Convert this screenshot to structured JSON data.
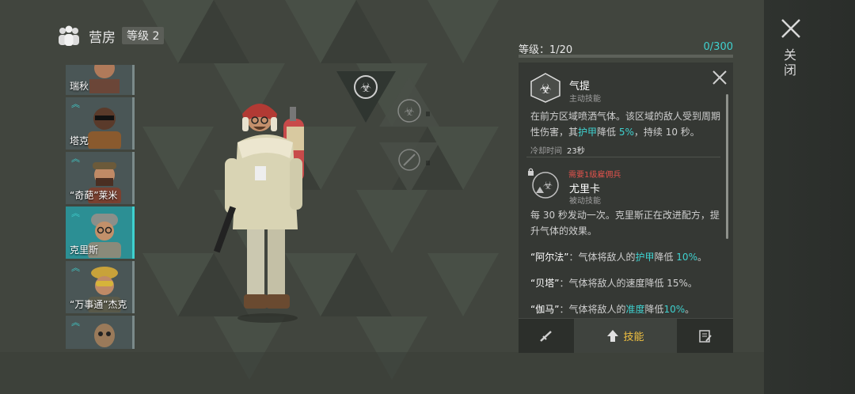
{
  "header": {
    "icon": "group-icon",
    "title": "营房",
    "level_badge": "等级 2"
  },
  "close": {
    "label": "关闭",
    "icon": "close-icon"
  },
  "roster": [
    {
      "name": "瑞秋",
      "rank_chevrons": 0,
      "selected": false
    },
    {
      "name": "塔克",
      "rank_chevrons": 1,
      "selected": false
    },
    {
      "name": "“奇葩”莱米",
      "rank_chevrons": 1,
      "selected": false
    },
    {
      "name": "克里斯",
      "rank_chevrons": 1,
      "selected": true
    },
    {
      "name": "“万事通”杰克",
      "rank_chevrons": 1,
      "selected": false
    },
    {
      "name": "",
      "rank_chevrons": 1,
      "selected": false
    }
  ],
  "level": {
    "label": "等级：1/20",
    "xp": "0/300",
    "xp_fraction": 0
  },
  "skill1": {
    "name": "气提",
    "type": "主动技能",
    "desc_a": "在前方区域喷洒气体。该区域的敌人受到周期性伤害，其",
    "desc_hl1": "护甲",
    "desc_b": "降低 ",
    "desc_hl2": "5%",
    "desc_c": "，持续 10 秒。",
    "cooldown_label": "冷却时间",
    "cooldown_value": "23秒"
  },
  "skill2": {
    "requirement": "需要1级雇佣兵",
    "name": "尤里卡",
    "type": "被动技能",
    "desc": "每 30 秒发动一次。克里斯正在改进配方，提升气体的效果。"
  },
  "upgrades": [
    {
      "name": "“阿尔法”",
      "pre": "：气体将敌人的",
      "hl": "护甲",
      "post": "降低 ",
      "val": "10%",
      "end": "。"
    },
    {
      "name": "“贝塔”",
      "pre": "：气体将敌人的速度降低 15%。",
      "hl": "",
      "post": "",
      "val": "",
      "end": ""
    },
    {
      "name": "“伽马”",
      "pre": "：气体将敌人的",
      "hl": "准度",
      "post": "降低",
      "val": "10%",
      "end": "。"
    }
  ],
  "tabs": [
    {
      "icon": "weapon-icon",
      "label": ""
    },
    {
      "icon": "skill-upgrade-icon",
      "label": "技能",
      "active": true
    },
    {
      "icon": "notes-icon",
      "label": ""
    }
  ],
  "colors": {
    "accent": "#3fd1cf",
    "gold": "#f0c040",
    "warning": "#e0524c"
  }
}
